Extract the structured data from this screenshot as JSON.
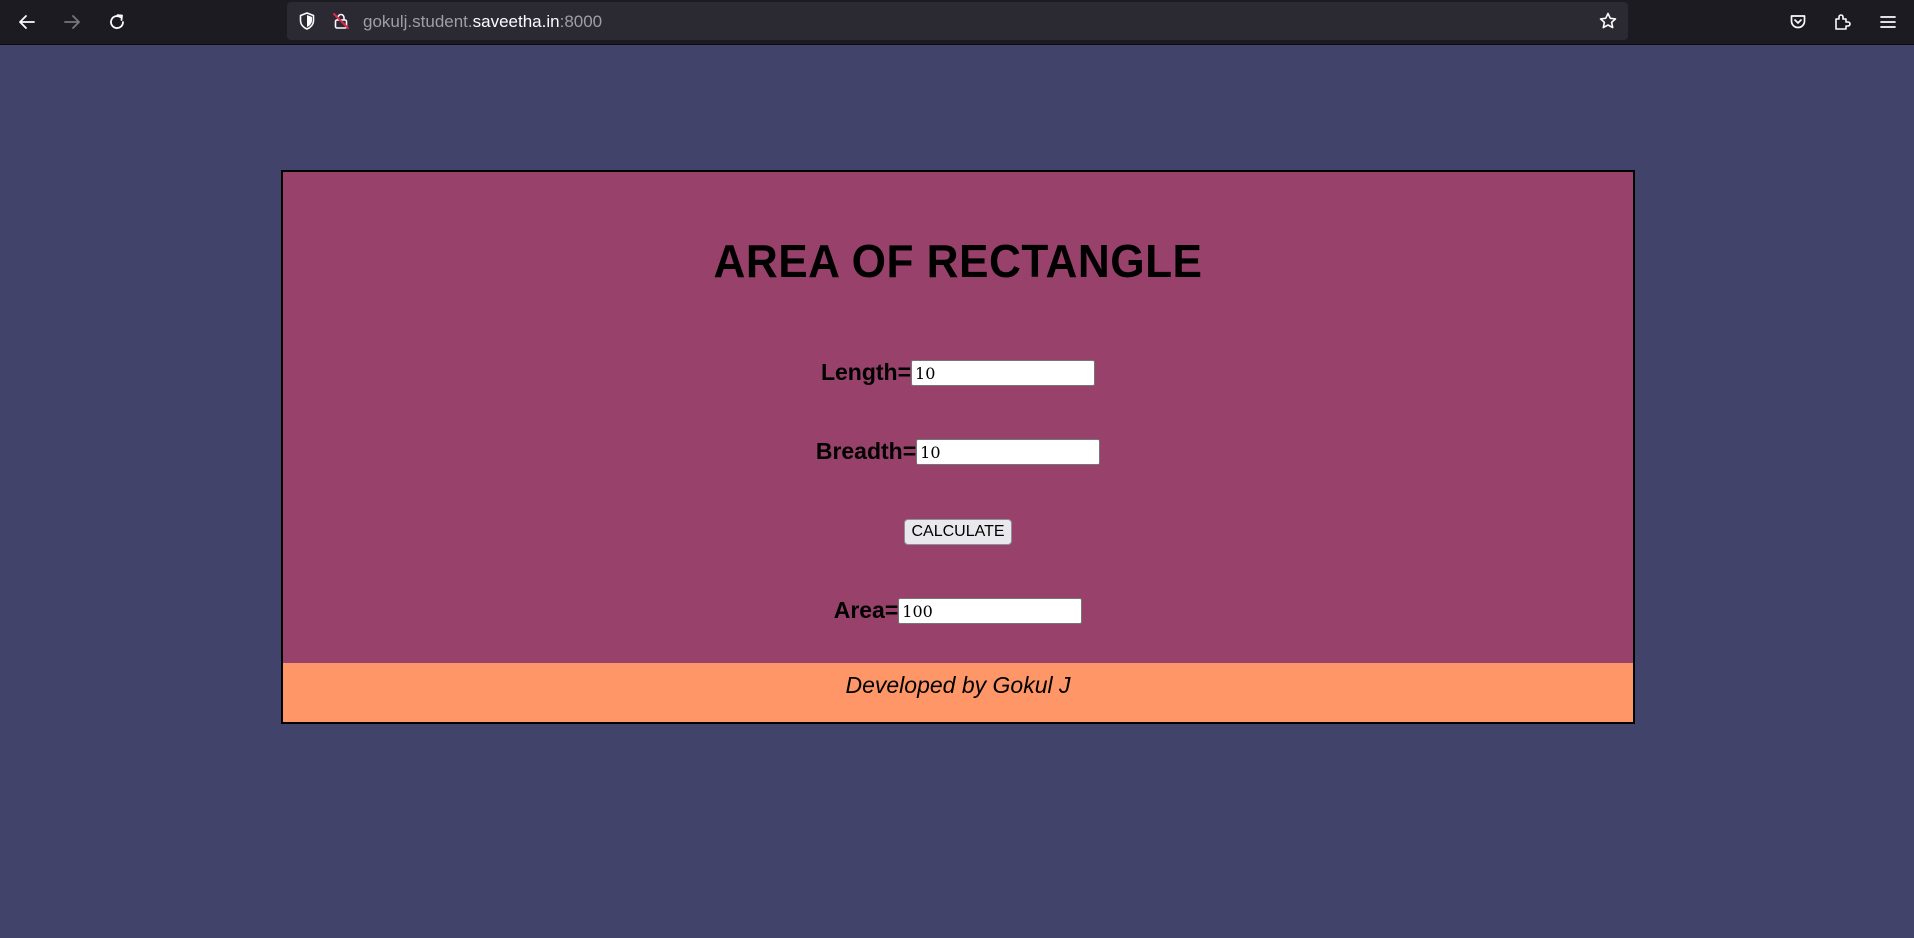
{
  "browser": {
    "url_prefix": "gokulj.student.",
    "url_host": "saveetha.in",
    "url_port": ":8000"
  },
  "page": {
    "title": "AREA OF RECTANGLE",
    "length_label": "Length=",
    "length_value": "10",
    "breadth_label": "Breadth=",
    "breadth_value": "10",
    "calculate_label": "CALCULATE",
    "area_label": "Area=",
    "area_value": "100",
    "footer_text": "Developed by Gokul J"
  },
  "colors": {
    "page_background": "#41436a",
    "card_background": "#98416a",
    "footer_background": "#ff9668"
  }
}
